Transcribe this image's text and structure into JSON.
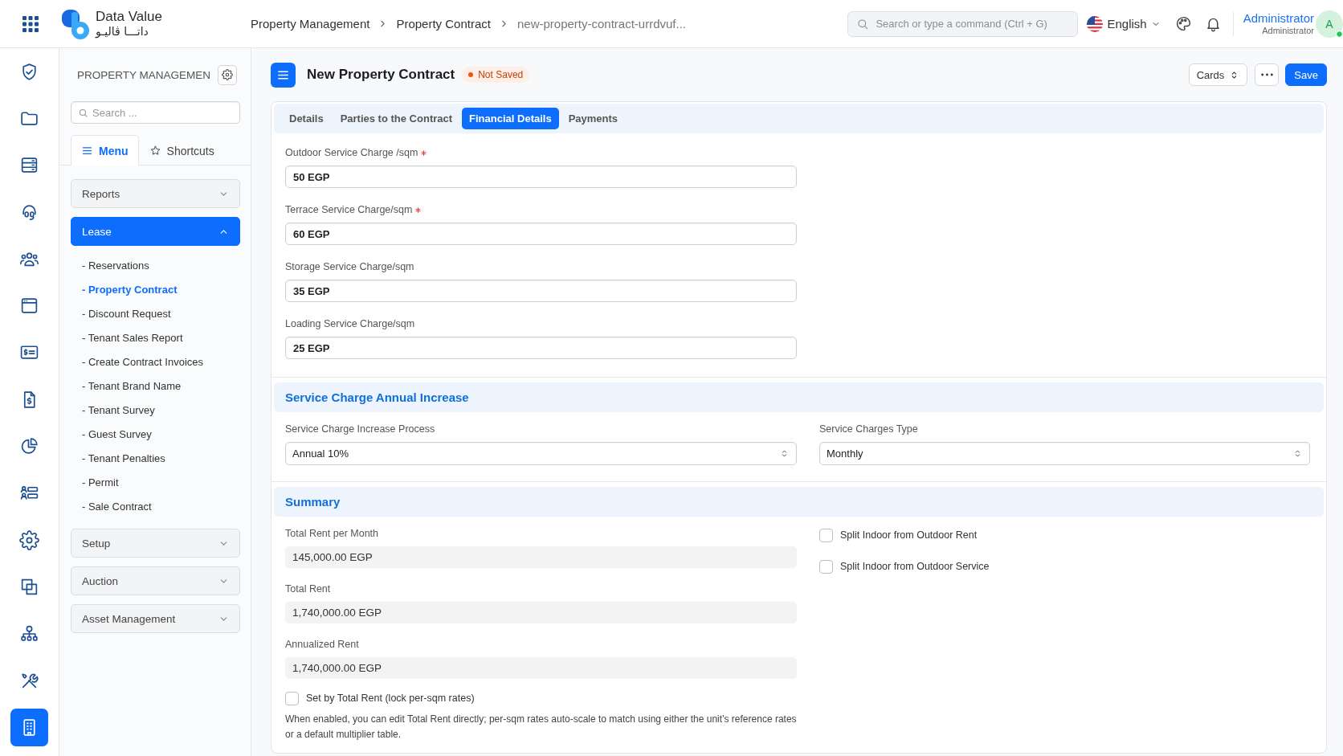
{
  "topbar": {
    "brand": {
      "name": "Data Value",
      "name_arabic": "داتـــا ڤاليـو"
    },
    "breadcrumbs": [
      {
        "label": "Property Management",
        "current": false
      },
      {
        "label": "Property Contract",
        "current": false
      },
      {
        "label": "new-property-contract-urrdvuf...",
        "current": true
      }
    ],
    "search": {
      "placeholder": "Search or type a command (Ctrl + G)"
    },
    "language": "English",
    "user": {
      "name": "Administrator",
      "role": "Administrator",
      "initial": "A",
      "online": true
    }
  },
  "rail": [
    {
      "selected": false
    },
    {
      "selected": false
    },
    {
      "selected": false
    },
    {
      "selected": false
    },
    {
      "selected": false
    },
    {
      "selected": false
    },
    {
      "selected": false
    },
    {
      "selected": false
    },
    {
      "selected": false
    },
    {
      "selected": false
    },
    {
      "selected": false
    },
    {
      "selected": false
    },
    {
      "selected": false
    },
    {
      "selected": false
    },
    {
      "selected": true
    }
  ],
  "sidebar": {
    "title": "PROPERTY MANAGEMEN",
    "search": {
      "placeholder": "Search ..."
    },
    "tabs": [
      {
        "label": "Menu",
        "selected": true
      },
      {
        "label": "Shortcuts",
        "selected": false
      }
    ],
    "groups": [
      {
        "label": "Reports",
        "expanded": false
      },
      {
        "label": "Lease",
        "expanded": true,
        "items": [
          {
            "label": "- Reservations",
            "selected": false
          },
          {
            "label": "- Property Contract",
            "selected": true
          },
          {
            "label": "- Discount Request",
            "selected": false
          },
          {
            "label": "- Tenant Sales Report",
            "selected": false
          },
          {
            "label": "- Create Contract Invoices",
            "selected": false
          },
          {
            "label": "- Tenant Brand Name",
            "selected": false
          },
          {
            "label": "- Tenant Survey",
            "selected": false
          },
          {
            "label": "- Guest Survey",
            "selected": false
          },
          {
            "label": "- Tenant Penalties",
            "selected": false
          },
          {
            "label": "- Permit",
            "selected": false
          },
          {
            "label": "- Sale Contract",
            "selected": false
          }
        ]
      },
      {
        "label": "Setup",
        "expanded": false
      },
      {
        "label": "Auction",
        "expanded": false
      },
      {
        "label": "Asset Management",
        "expanded": false
      }
    ]
  },
  "document": {
    "title": "New Property Contract",
    "status": "Not Saved",
    "view": "Cards",
    "save": "Save",
    "tabs": [
      {
        "label": "Details",
        "selected": false
      },
      {
        "label": "Parties to the Contract",
        "selected": false
      },
      {
        "label": "Financial Details",
        "selected": true
      },
      {
        "label": "Payments",
        "selected": false
      }
    ],
    "sections": [
      {
        "columns": [
          [
            {
              "kind": "input",
              "label": "Outdoor Service Charge /sqm",
              "required": true,
              "value": "50 EGP"
            },
            {
              "kind": "input",
              "label": "Terrace Service Charge/sqm",
              "required": true,
              "value": "60 EGP"
            },
            {
              "kind": "input",
              "label": "Storage Service Charge/sqm",
              "required": false,
              "value": "35 EGP"
            },
            {
              "kind": "input",
              "label": "Loading Service Charge/sqm",
              "required": false,
              "value": "25 EGP"
            }
          ]
        ]
      },
      {
        "title": "Service Charge Annual Increase",
        "columns": [
          [
            {
              "kind": "select",
              "label": "Service Charge Increase Process",
              "required": false,
              "value": "Annual 10%"
            }
          ],
          [
            {
              "kind": "select",
              "label": "Service Charges Type",
              "required": false,
              "value": "Monthly"
            }
          ]
        ]
      },
      {
        "title": "Summary",
        "columns": [
          [
            {
              "kind": "readonly",
              "label": "Total Rent per Month",
              "required": false,
              "value": "145,000.00 EGP"
            },
            {
              "kind": "readonly",
              "label": "Total Rent",
              "required": false,
              "value": "1,740,000.00 EGP"
            },
            {
              "kind": "readonly",
              "label": "Annualized Rent",
              "required": false,
              "value": "1,740,000.00 EGP"
            },
            {
              "kind": "checkbox",
              "label": "Set by Total Rent (lock per-sqm rates)",
              "checked": false
            },
            {
              "kind": "help",
              "text": "When enabled, you can edit Total Rent directly; per-sqm rates auto-scale to match using either the unit’s reference rates or a default multiplier table."
            }
          ],
          [
            {
              "kind": "checkbox",
              "label": "Split Indoor from Outdoor Rent",
              "checked": false
            },
            {
              "kind": "checkbox",
              "label": "Split Indoor from Outdoor Service",
              "checked": false
            }
          ]
        ]
      }
    ]
  }
}
